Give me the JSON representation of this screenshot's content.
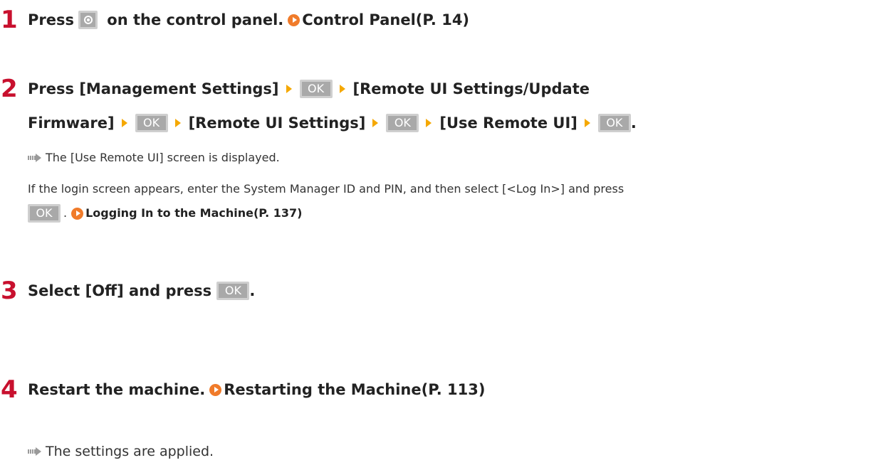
{
  "step1": {
    "number": "1",
    "text_before": "Press",
    "text_after": " on the control panel.",
    "link": "Control Panel(P. 14)"
  },
  "ok_label": "OK",
  "step2": {
    "number": "2",
    "text_press": "Press ",
    "item1": "[Management Settings]",
    "item2a": "[Remote UI Settings/Update",
    "item2b": "Firmware]",
    "item3": "[Remote UI Settings]",
    "item4": "[Use Remote UI]",
    "end": ".",
    "result": "The [Use Remote UI] screen is displayed.",
    "note_line1": "If the login screen appears, enter the System Manager ID and PIN, and then select [<Log In>] and press",
    "note_after_ok": ".",
    "note_link": "Logging In to the Machine(P. 137)"
  },
  "step3": {
    "number": "3",
    "text": "Select [Off] and press ",
    "end": "."
  },
  "step4": {
    "number": "4",
    "text": "Restart the machine.",
    "link": "Restarting the Machine(P. 113)",
    "result": "The settings are applied."
  },
  "colors": {
    "step_number": "#c8102e",
    "separator_arrow": "#f5a800",
    "link_icon": "#f07b2a",
    "ok_button": "#a9a9a9"
  },
  "icons": {
    "home": "home-button-icon",
    "link": "link-arrow-icon",
    "result": "result-arrow-icon"
  }
}
